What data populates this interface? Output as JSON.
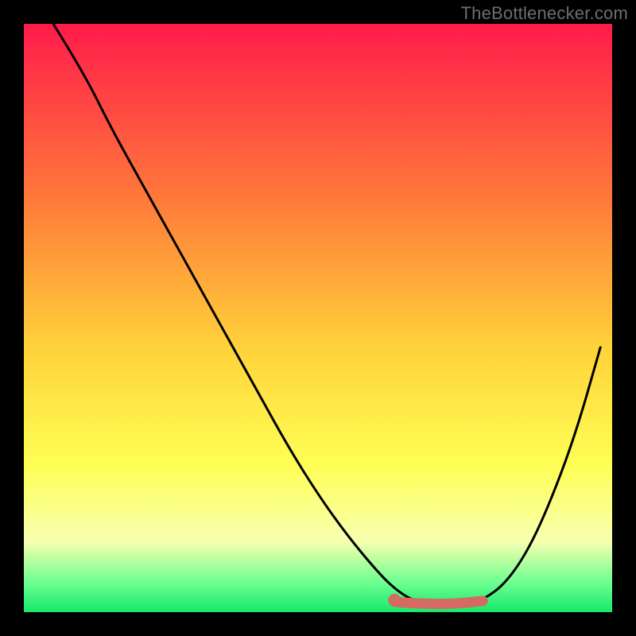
{
  "attribution": "TheBottlenecker.com",
  "colors": {
    "gradient_top": "#ff1b4b",
    "gradient_mid1": "#ff7a3a",
    "gradient_mid2": "#ffd23a",
    "gradient_mid3": "#ffff55",
    "gradient_bottom1": "#f7ffb0",
    "gradient_bottom2": "#6cff8f",
    "gradient_bottom3": "#17e86b",
    "curve": "#000000",
    "marker": "#d56a63",
    "background": "#000000"
  },
  "chart_data": {
    "type": "line",
    "title": "",
    "xlabel": "",
    "ylabel": "",
    "xlim": [
      0,
      100
    ],
    "ylim": [
      0,
      100
    ],
    "series": [
      {
        "name": "bottleneck-curve",
        "x": [
          5,
          10,
          15,
          20,
          25,
          30,
          35,
          40,
          45,
          50,
          55,
          60,
          63,
          66,
          70,
          74,
          78,
          82,
          86,
          90,
          94,
          98
        ],
        "y": [
          100,
          92,
          82,
          73,
          64,
          55,
          46,
          37,
          28,
          20,
          13,
          7,
          4,
          2,
          1,
          1,
          2,
          5,
          11,
          20,
          31,
          45
        ]
      }
    ],
    "markers": {
      "name": "optimal-range",
      "x_range": [
        63,
        78
      ],
      "y": 1.5,
      "style": "thick-rounded"
    },
    "grid": false,
    "legend": false
  }
}
